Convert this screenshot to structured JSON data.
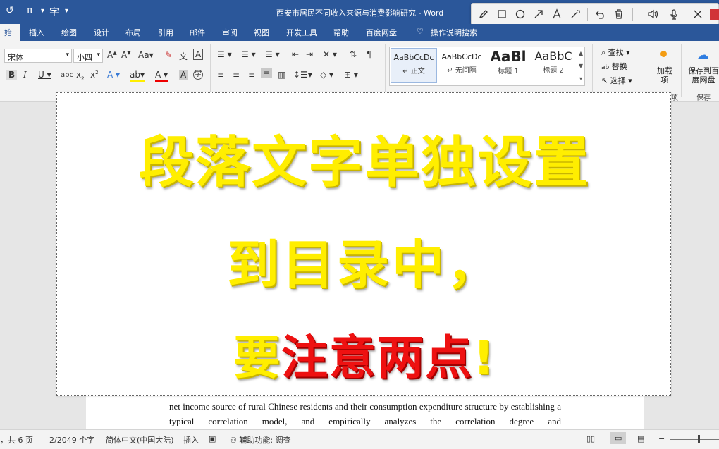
{
  "titlebar": {
    "quick_access": [
      "↺",
      "π",
      "字"
    ],
    "doc_title": "西安市居民不同收入来源与消费影响研究 - Word"
  },
  "pen_toolbar": {
    "tools": [
      "pen-icon",
      "rectangle-icon",
      "circle-icon",
      "arrow-icon",
      "text-icon",
      "magic-wand-icon",
      "undo-icon",
      "trash-icon",
      "speaker-icon",
      "microphone-icon",
      "close-icon"
    ]
  },
  "menu": {
    "active_tab": "始",
    "tabs": [
      "插入",
      "绘图",
      "设计",
      "布局",
      "引用",
      "邮件",
      "审阅",
      "视图",
      "开发工具",
      "帮助",
      "百度网盘"
    ],
    "tell_me": "操作说明搜索"
  },
  "ribbon": {
    "font_name": "宋体",
    "font_size": "小四",
    "styles": [
      {
        "sample": "AaBbCcDc",
        "name": "↵ 正文"
      },
      {
        "sample": "AaBbCcDc",
        "name": "↵ 无间隔"
      },
      {
        "sample": "AaBl",
        "name": "标题 1"
      },
      {
        "sample": "AaBbC",
        "name": "标题 2"
      }
    ],
    "find": "查找",
    "replace": "替换",
    "select": "选择",
    "addin_label": "加载项",
    "addin_group": "项",
    "save_label": "保存到百度网盘",
    "save_group": "保存"
  },
  "document": {
    "body_text": "net income source of rural Chinese residents and their consumption expenditure structure by establishing a typical correlation model, and empirically analyzes the correlation degree and"
  },
  "overlay": {
    "line1": "段落文字单独设置",
    "line2": "到目录中，",
    "line3_prefix": "要",
    "line3_red": "注意两点",
    "line3_suffix": "!"
  },
  "statusbar": {
    "pages": "，共 6 页",
    "words": "2/2049 个字",
    "language": "简体中文(中国大陆)",
    "mode": "插入",
    "accessibility": "辅助功能: 调查"
  },
  "colors": {
    "accent": "#2b579a",
    "overlay_yellow": "#ffee00",
    "overlay_red": "#ee1111"
  }
}
